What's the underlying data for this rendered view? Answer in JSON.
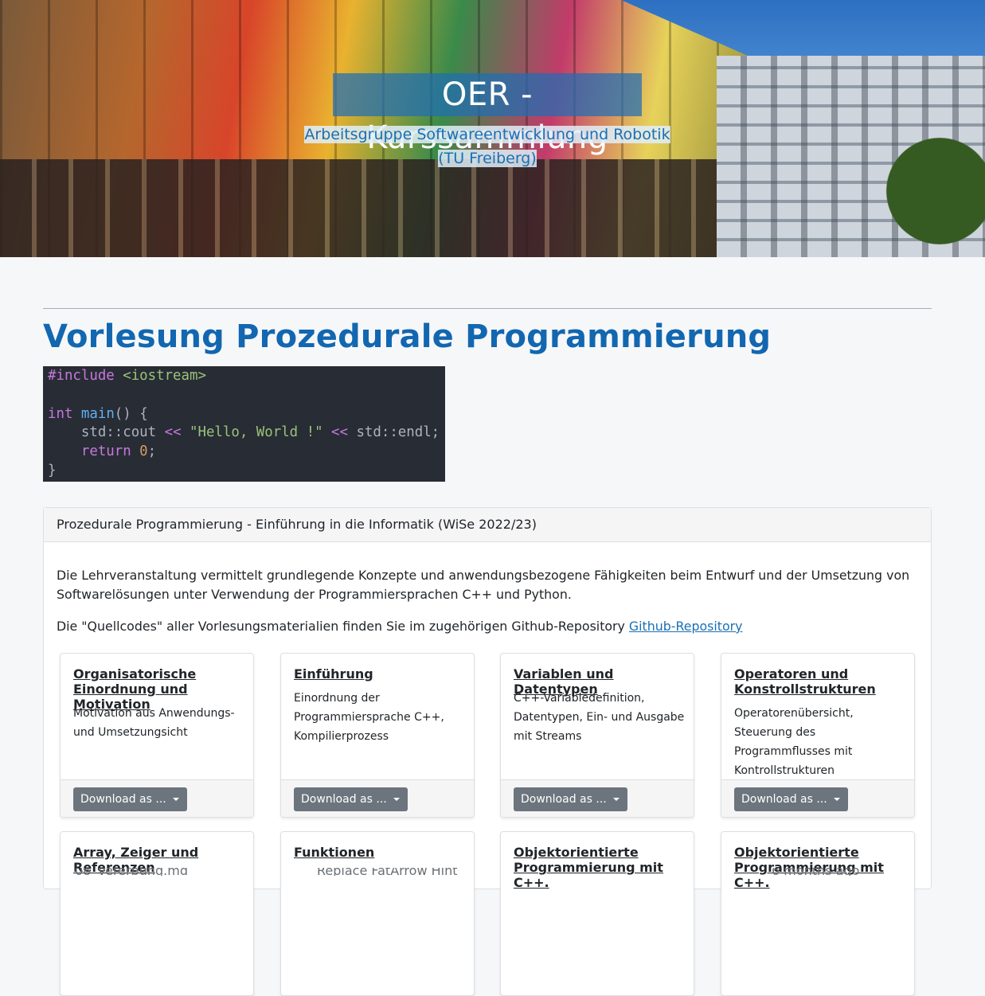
{
  "header": {
    "title": "OER - Kurssammlung",
    "subtitle": "Arbeitsgruppe Softwareentwicklung und Robotik (TU Freiberg)"
  },
  "page": {
    "title": "Vorlesung Prozedurale Programmierung"
  },
  "code_sample": {
    "line1_directive": "#include",
    "line1_header": " <iostream>",
    "line3_type": "int",
    "line3_fn": "main",
    "line3_rest": "() {",
    "line4_pre": "    std::cout ",
    "line4_op1": "<<",
    "line4_str": " \"Hello, World !\"",
    "line4_op2": " <<",
    "line4_post": " std::endl;",
    "line5_kw": "    return",
    "line5_num": " 0",
    "line5_end": ";",
    "line6": "}"
  },
  "course": {
    "header": "Prozedurale Programmierung - Einführung in die Informatik (WiSe 2022/23)",
    "description": "Die Lehrveranstaltung vermittelt grundlegende Konzepte und anwendungsbezogene Fähigkeiten beim Entwurf und der Umsetzung von Softwarelösungen unter Verwendung der Programmiersprachen C++ und Python.",
    "repo_text": "Die \"Quellcodes\" aller Vorlesungsmaterialien finden Sie im zugehörigen Github-Repository ",
    "repo_link": "Github-Repository"
  },
  "lectures": [
    {
      "title": "Organisatorische Einordnung und Motivation",
      "description": "Motivation aus Anwendungs- und Umsetzungsicht",
      "download_label": "Download as ..."
    },
    {
      "title": "Einführung",
      "description": "Einordnung der Programmiersprache C++, Kompilierprozess",
      "download_label": "Download as ..."
    },
    {
      "title": "Variablen und Datentypen",
      "description": "C++-Variabledefinition, Datentypen, Ein- und Ausgabe mit Streams",
      "download_label": "Download as ..."
    },
    {
      "title": "Operatoren und Konstrollstrukturen",
      "description": "Operatorenübersicht, Steuerung des Programmflusses mit Kontrollstrukturen",
      "download_label": "Download as ..."
    },
    {
      "title": "Array, Zeiger und Referenzen",
      "description": "",
      "download_label": ""
    },
    {
      "title": "Funktionen",
      "description": "",
      "download_label": ""
    },
    {
      "title": "Objektorientierte Programmierung mit C++.",
      "description": "",
      "download_label": ""
    },
    {
      "title": "Objektorientierte Programmierung mit C++.",
      "description": "",
      "download_label": ""
    }
  ],
  "overlay_strip": {
    "file": "08_Vererbung.md",
    "commit": "Replace FatArrow Hint",
    "age": "6 months ago"
  }
}
